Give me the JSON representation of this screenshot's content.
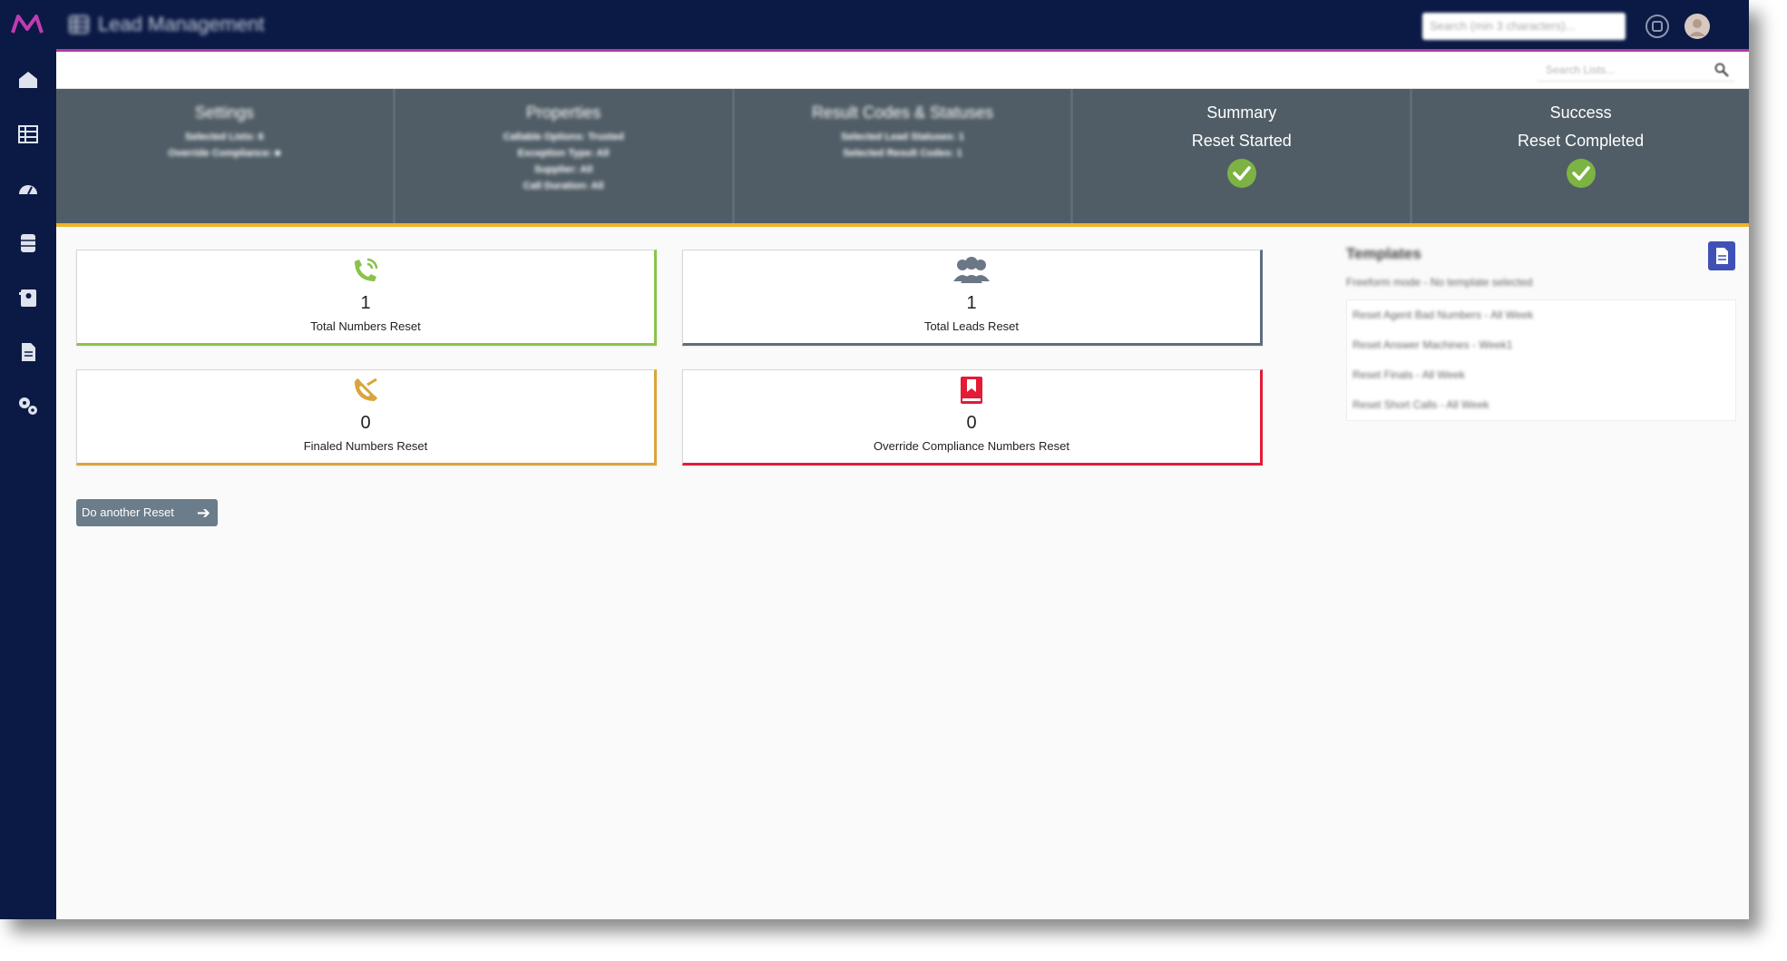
{
  "app": {
    "title": "Lead Management",
    "search_placeholder": "Search (min 3 characters)...",
    "list_search_placeholder": "Search Lists..."
  },
  "sidebar": {
    "icons": [
      "home-icon",
      "grid-icon",
      "dashboard-icon",
      "database-icon",
      "contacts-icon",
      "document-icon",
      "settings-icon"
    ]
  },
  "steps": [
    {
      "title": "Settings",
      "lines": [
        "Selected Lists: 6",
        "Override Compliance: ■"
      ]
    },
    {
      "title": "Properties",
      "lines": [
        "Callable Options: Trusted",
        "Exception Type: All",
        "Supplier: All",
        "Call Duration: All"
      ]
    },
    {
      "title": "Result Codes & Statuses",
      "lines": [
        "Selected Lead Statuses: 1",
        "Selected Result Codes: 1"
      ]
    },
    {
      "title": "Summary",
      "sub": "Reset Started"
    },
    {
      "title": "Success",
      "sub": "Reset Completed"
    }
  ],
  "cards": [
    {
      "value": "1",
      "label": "Total Numbers Reset",
      "color": "#8bc34a",
      "icon": "phone-ringing-icon"
    },
    {
      "value": "1",
      "label": "Total Leads Reset",
      "color": "#5f6c7f",
      "icon": "users-icon"
    },
    {
      "value": "0",
      "label": "Finaled Numbers Reset",
      "color": "#d9a53a",
      "icon": "phone-off-icon"
    },
    {
      "value": "0",
      "label": "Override Compliance Numbers Reset",
      "color": "#e31b35",
      "icon": "bookmark-book-icon"
    }
  ],
  "reset_button": {
    "label": "Do another Reset"
  },
  "templates": {
    "title": "Templates",
    "mode": "Freeform mode - No template selected",
    "items": [
      "Reset Agent Bad Numbers - All Week",
      "Reset Answer Machines - Week1",
      "Reset Finals - All Week",
      "Reset Short Calls - All Week"
    ]
  },
  "colors": {
    "nav": "#0b1a45",
    "accent": "#b03aa7",
    "stepper": "#505d66",
    "progress": "#f0b429",
    "check": "#7cb342"
  }
}
